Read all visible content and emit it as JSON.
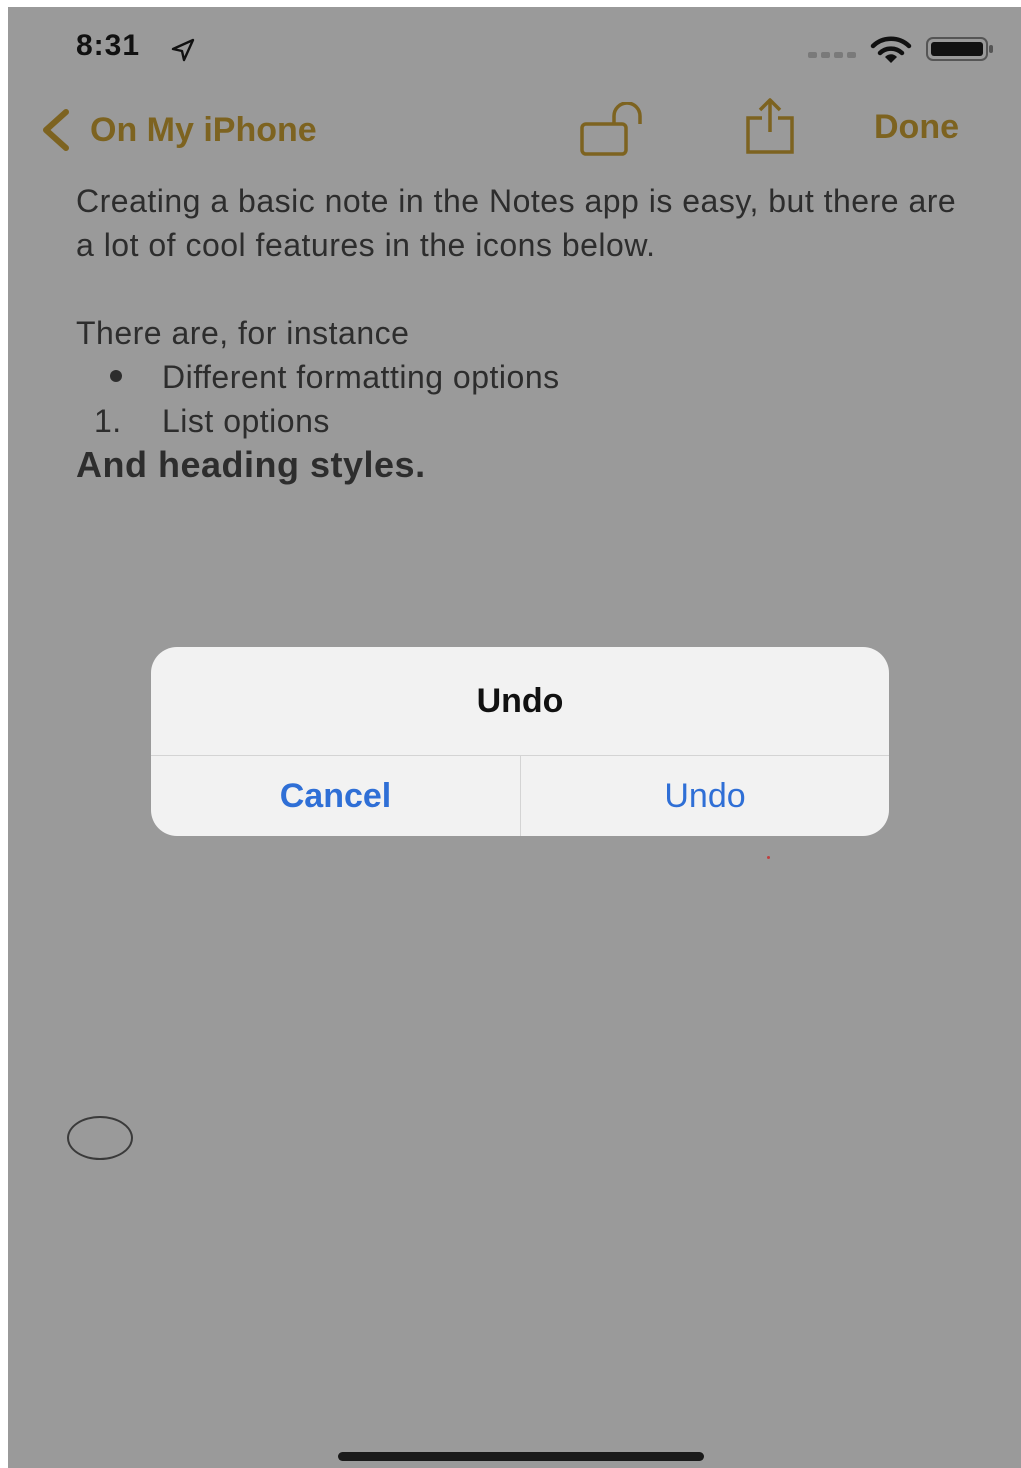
{
  "status_bar": {
    "time": "8:31",
    "icons": [
      "location-arrow-icon",
      "cellular-signal-icon",
      "wifi-icon",
      "battery-icon"
    ]
  },
  "nav_bar": {
    "back_label": "On My iPhone",
    "done_label": "Done",
    "icons": [
      "chevron-left-icon",
      "unlock-icon",
      "share-icon"
    ],
    "accent_color": "#7d6320"
  },
  "note": {
    "paragraph": "Creating a basic note in the Notes app is easy, but there are a lot of cool features in the icons below.",
    "intro": "There are, for instance",
    "bullet_item": "Different formatting options",
    "numbered_marker": "1.",
    "numbered_item": "List options",
    "heading": "And heading styles."
  },
  "alert": {
    "title": "Undo",
    "cancel_label": "Cancel",
    "undo_label": "Undo",
    "button_color": "#2f6fd6"
  }
}
